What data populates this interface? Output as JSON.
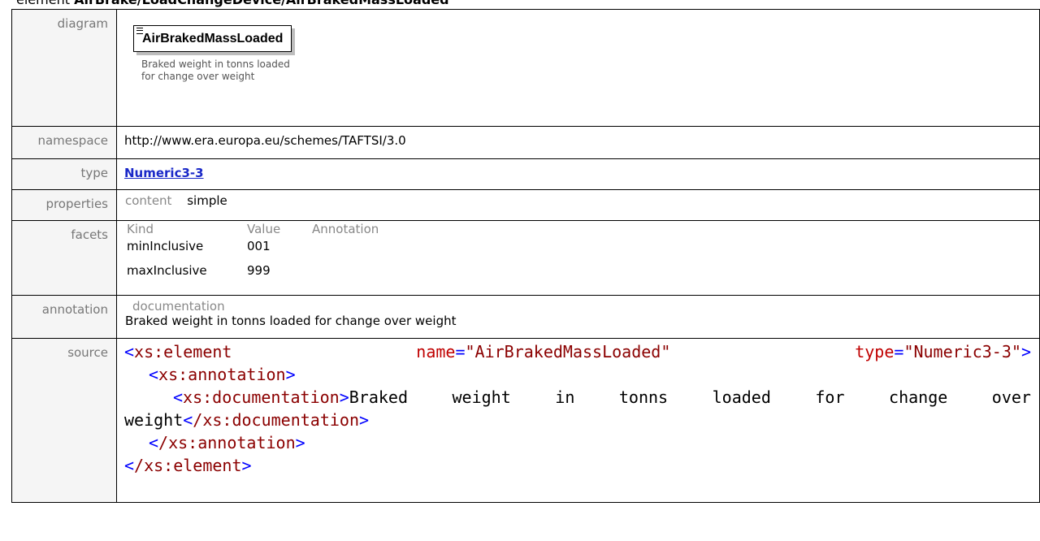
{
  "heading": {
    "prefix": "element",
    "path": "AirBrake/LoadChangeDevice/AirBrakedMassLoaded"
  },
  "labels": {
    "diagram": "diagram",
    "namespace": "namespace",
    "type": "type",
    "properties": "properties",
    "facets": "facets",
    "annotation": "annotation",
    "source": "source"
  },
  "diagram": {
    "element_name": "AirBrakedMassLoaded",
    "doc_line1": "Braked weight in tonns loaded",
    "doc_line2": "for change over weight"
  },
  "namespace": "http://www.era.europa.eu/schemes/TAFTSI/3.0",
  "type": "Numeric3-3",
  "properties": {
    "key": "content",
    "value": "simple"
  },
  "facets": {
    "headers": [
      "Kind",
      "Value",
      "Annotation"
    ],
    "rows": [
      {
        "kind": "minInclusive",
        "value": "001",
        "annotation": ""
      },
      {
        "kind": "maxInclusive",
        "value": "999",
        "annotation": ""
      }
    ]
  },
  "annotation": {
    "key": "documentation",
    "text": "Braked weight in tonns loaded for change over weight"
  },
  "source": {
    "line1": {
      "tag": "xs:element",
      "attr1": "name",
      "val1": "\"AirBrakedMassLoaded\"",
      "attr2": "type",
      "val2": "\"Numeric3-3\""
    },
    "annotation_tag": "xs:annotation",
    "documentation_tag": "xs:documentation",
    "doc_words": [
      "Braked",
      "weight",
      "in",
      "tonns",
      "loaded",
      "for",
      "change",
      "over"
    ],
    "doc_last_word": "weight",
    "close_documentation": "/xs:documentation",
    "close_annotation": "/xs:annotation",
    "close_element": "/xs:element"
  }
}
